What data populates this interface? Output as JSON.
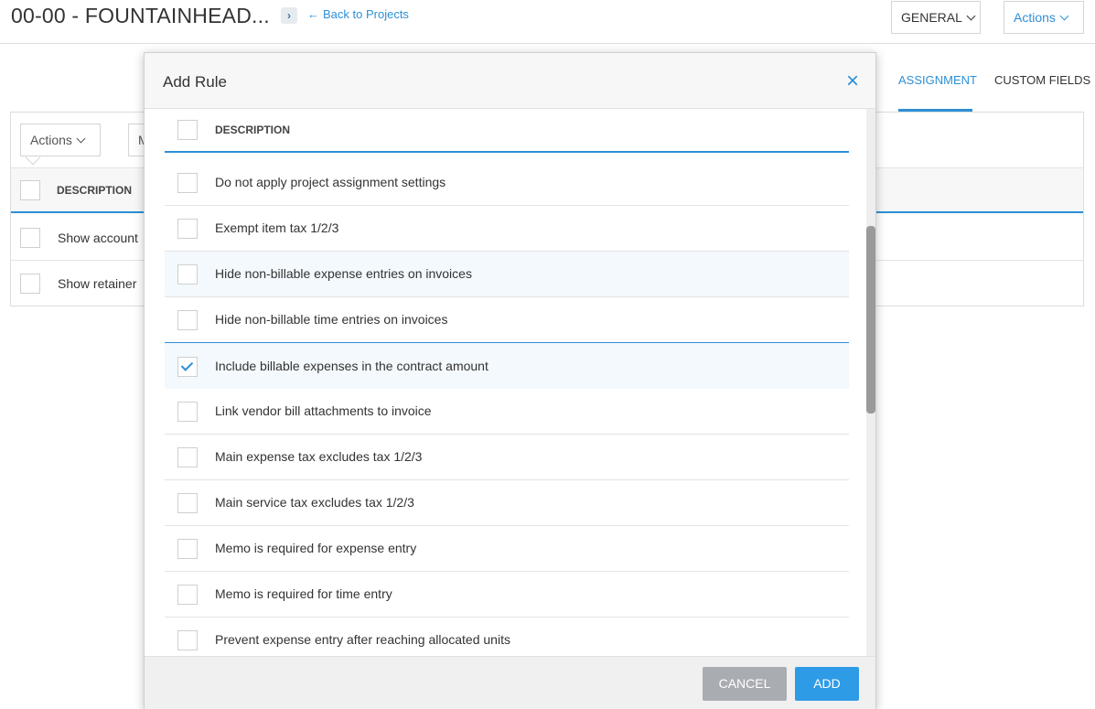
{
  "header": {
    "project_title": "00-00 - FOUNTAINHEAD...",
    "back_link": "Back to Projects",
    "general_button": "GENERAL",
    "actions_button": "Actions"
  },
  "tabs": {
    "assignment": "ASSIGNMENT",
    "custom_fields": "CUSTOM FIELDS"
  },
  "background_table": {
    "actions_button": "Actions",
    "second_button_partial": "M",
    "column_header": "DESCRIPTION",
    "rows": [
      "Show account",
      "Show retainer"
    ]
  },
  "modal": {
    "title": "Add Rule",
    "column_header": "DESCRIPTION",
    "items": [
      {
        "label": "Do not apply project assignment settings",
        "checked": false
      },
      {
        "label": "Exempt item tax 1/2/3",
        "checked": false
      },
      {
        "label": "Hide non-billable expense entries on invoices",
        "checked": false
      },
      {
        "label": "Hide non-billable time entries on invoices",
        "checked": false
      },
      {
        "label": "Include billable expenses in the contract amount",
        "checked": true
      },
      {
        "label": "Link vendor bill attachments to invoice",
        "checked": false
      },
      {
        "label": "Main expense tax excludes tax 1/2/3",
        "checked": false
      },
      {
        "label": "Main service tax excludes tax 1/2/3",
        "checked": false
      },
      {
        "label": "Memo is required for expense entry",
        "checked": false
      },
      {
        "label": "Memo is required for time entry",
        "checked": false
      },
      {
        "label": "Prevent expense entry after reaching allocated units",
        "checked": false
      }
    ],
    "cancel_label": "CANCEL",
    "add_label": "ADD"
  },
  "colors": {
    "accent": "#2e8fd6",
    "add_button": "#2e9be6",
    "cancel_button": "#a9adb2"
  }
}
